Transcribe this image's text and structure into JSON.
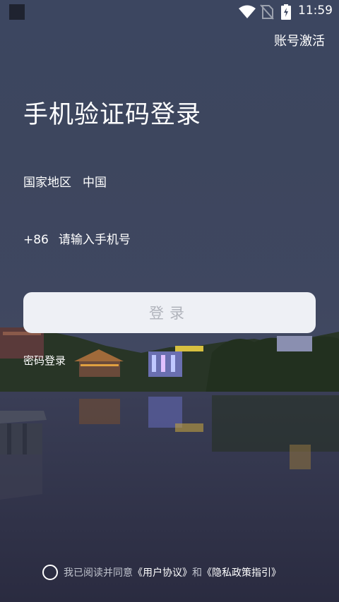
{
  "status_bar": {
    "time": "11:59",
    "icons": [
      "app-square-icon",
      "wifi-icon",
      "no-sim-icon",
      "battery-charging-icon"
    ]
  },
  "header": {
    "activate_label": "账号激活"
  },
  "main": {
    "title": "手机验证码登录",
    "region_label": "国家地区",
    "region_value": "中国",
    "country_code": "+86",
    "phone_placeholder": "请输入手机号",
    "login_button_label": "登录",
    "password_login_label": "密码登录"
  },
  "agreement": {
    "prefix": "我已阅读并同意",
    "user_agreement": "《用户协议》",
    "conjunction": "和",
    "privacy_policy": "《隐私政策指引》"
  },
  "colors": {
    "background_top": "#3c4660",
    "background_bottom": "#2b2c42",
    "button_bg": "#eef0f5",
    "button_text": "#b0b3bb"
  }
}
